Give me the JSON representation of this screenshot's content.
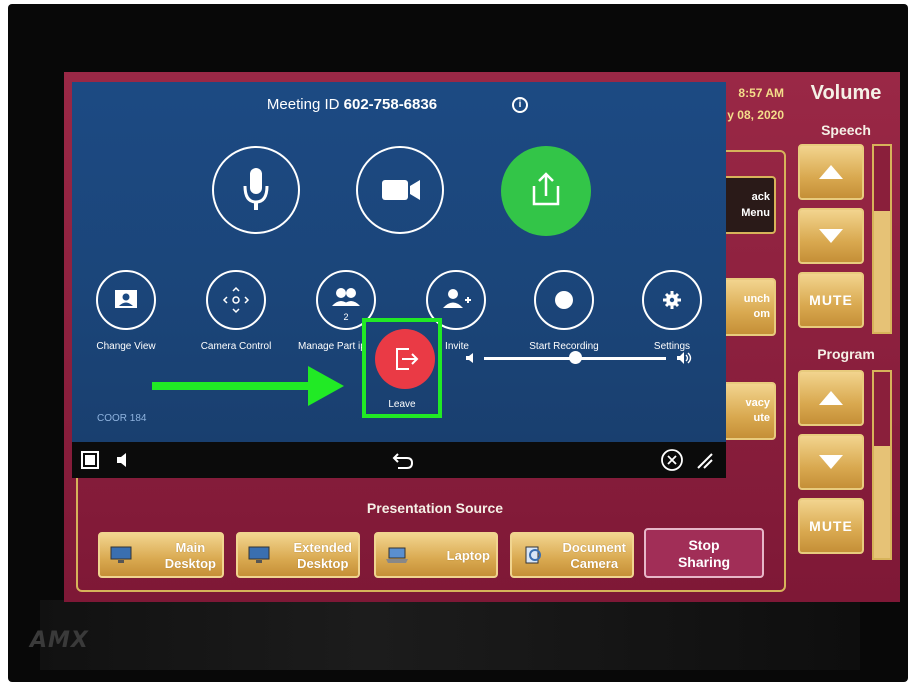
{
  "device": {
    "logo": "AMX"
  },
  "clock": {
    "time": "8:57 AM",
    "date": "y 08, 2020"
  },
  "volume": {
    "title": "Volume",
    "speech": {
      "label": "Speech",
      "mute_label": "MUTE",
      "level": 0.65
    },
    "program": {
      "label": "Program",
      "mute_label": "MUTE",
      "level": 0.6
    }
  },
  "side_buttons": {
    "back_menu": {
      "line1": "ack",
      "line2": "Menu"
    },
    "launch_room": {
      "line1": "unch",
      "line2": "om"
    },
    "privacy_mute": {
      "line1": "vacy",
      "line2": "ute"
    }
  },
  "presentation": {
    "title": "Presentation Source",
    "sources": [
      {
        "line1": "Main",
        "line2": "Desktop"
      },
      {
        "line1": "Extended",
        "line2": "Desktop"
      },
      {
        "line1": "Laptop",
        "line2": ""
      },
      {
        "line1": "Document",
        "line2": "Camera"
      }
    ],
    "stop": {
      "line1": "Stop",
      "line2": "Sharing"
    }
  },
  "zoom": {
    "meeting_id_label": "Meeting ID",
    "meeting_id": "602-758-6836",
    "info_glyph": "i",
    "controls": {
      "change_view": "Change View",
      "camera_control": "Camera Control",
      "manage_participants": "Manage Part  ip",
      "participant_count": "2",
      "invite": "Invite",
      "start_recording": "Start Recording",
      "settings": "Settings"
    },
    "volume_level": 0.5,
    "room_name": "COOR 184",
    "leave_label": "Leave"
  },
  "colors": {
    "screen_bg": "#8a1f3b",
    "gold": "#d9a950",
    "zoom_blue": "#1c4a83",
    "share_green": "#33c548",
    "leave_red": "#ea3a45",
    "highlight_green": "#21ea25"
  }
}
